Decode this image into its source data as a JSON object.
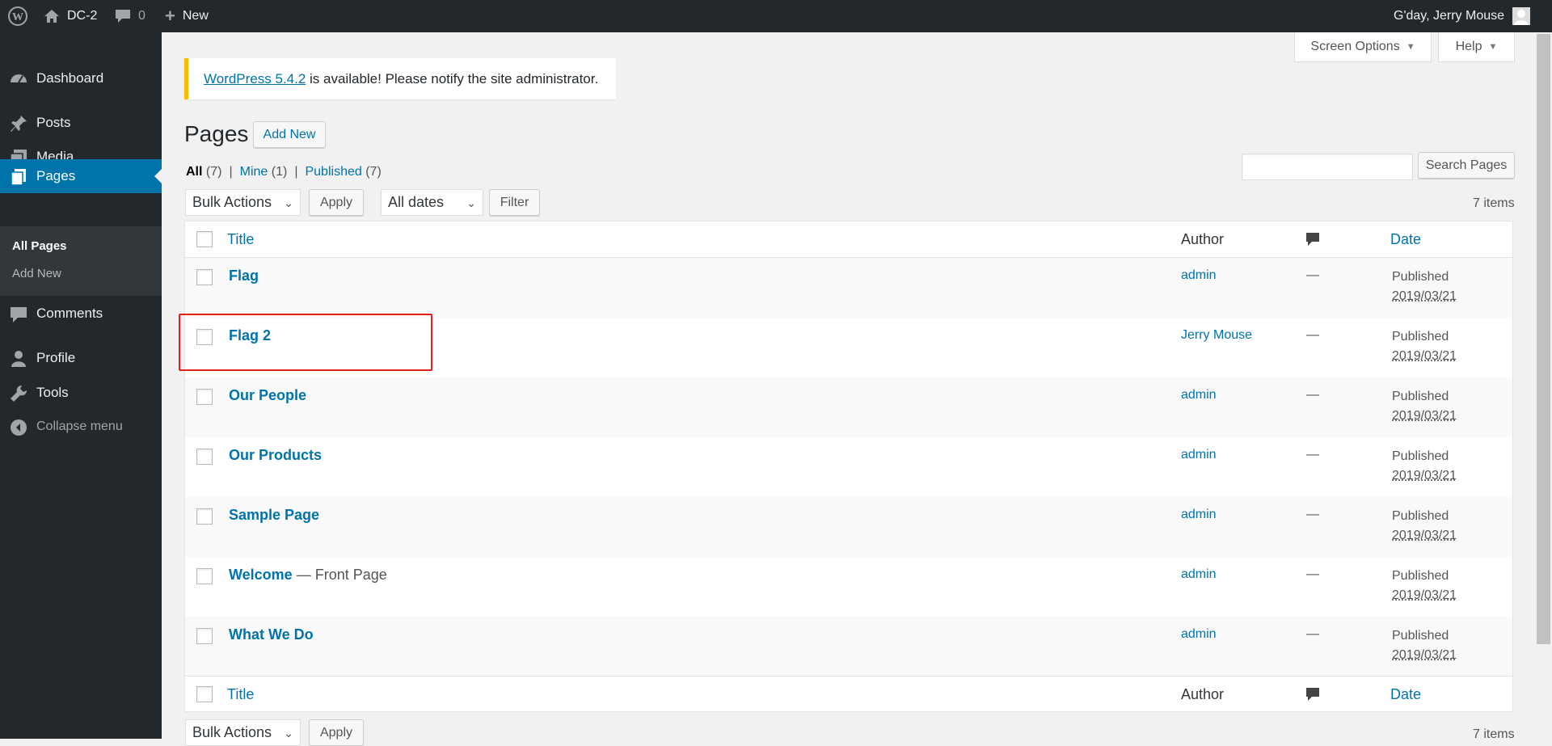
{
  "adminbar": {
    "site_name": "DC-2",
    "comments_count": "0",
    "new_label": "New",
    "greeting": "G'day, Jerry Mouse",
    "icons": [
      "wordpress-logo-icon",
      "home-icon",
      "comment-bubble-icon",
      "plus-icon",
      "avatar-icon"
    ]
  },
  "sidebar": {
    "items": [
      {
        "label": "Dashboard",
        "icon": "dashboard-icon"
      },
      {
        "label": "Posts",
        "icon": "pin-icon"
      },
      {
        "label": "Media",
        "icon": "media-icon"
      },
      {
        "label": "Pages",
        "icon": "pages-icon"
      },
      {
        "label": "Comments",
        "icon": "comment-icon"
      },
      {
        "label": "Profile",
        "icon": "user-icon"
      },
      {
        "label": "Tools",
        "icon": "wrench-icon"
      }
    ],
    "submenu": [
      "All Pages",
      "Add New"
    ],
    "collapse": "Collapse menu"
  },
  "screen_options": "Screen Options",
  "help": "Help",
  "notice": {
    "link": "WordPress 5.4.2",
    "text": " is available! Please notify the site administrator."
  },
  "page_title": "Pages",
  "add_new": "Add New",
  "filters": {
    "all": "All",
    "all_count": "(7)",
    "mine": "Mine",
    "mine_count": "(1)",
    "published": "Published",
    "published_count": "(7)",
    "sep": "|"
  },
  "search_button": "Search Pages",
  "bulk_actions": "Bulk Actions",
  "apply": "Apply",
  "all_dates": "All dates",
  "filter": "Filter",
  "items_count": "7 items",
  "columns": {
    "title": "Title",
    "author": "Author",
    "date": "Date"
  },
  "rows": [
    {
      "title": "Flag",
      "extra": "",
      "author": "admin",
      "comments": "—",
      "status": "Published",
      "date": "2019/03/21"
    },
    {
      "title": "Flag 2",
      "extra": "",
      "author": "Jerry Mouse",
      "comments": "—",
      "status": "Published",
      "date": "2019/03/21"
    },
    {
      "title": "Our People",
      "extra": "",
      "author": "admin",
      "comments": "—",
      "status": "Published",
      "date": "2019/03/21"
    },
    {
      "title": "Our Products",
      "extra": "",
      "author": "admin",
      "comments": "—",
      "status": "Published",
      "date": "2019/03/21"
    },
    {
      "title": "Sample Page",
      "extra": "",
      "author": "admin",
      "comments": "—",
      "status": "Published",
      "date": "2019/03/21"
    },
    {
      "title": "Welcome",
      "extra": " — Front Page",
      "author": "admin",
      "comments": "—",
      "status": "Published",
      "date": "2019/03/21"
    },
    {
      "title": "What We Do",
      "extra": "",
      "author": "admin",
      "comments": "—",
      "status": "Published",
      "date": "2019/03/21"
    }
  ],
  "bottom": {
    "bulk_actions": "Bulk Actions",
    "apply": "Apply",
    "items_count": "7 items"
  },
  "colors": {
    "adminbar": "#23282d",
    "accent": "#0073aa",
    "notice": "#ffb900",
    "highlight": "#e51d1d"
  }
}
